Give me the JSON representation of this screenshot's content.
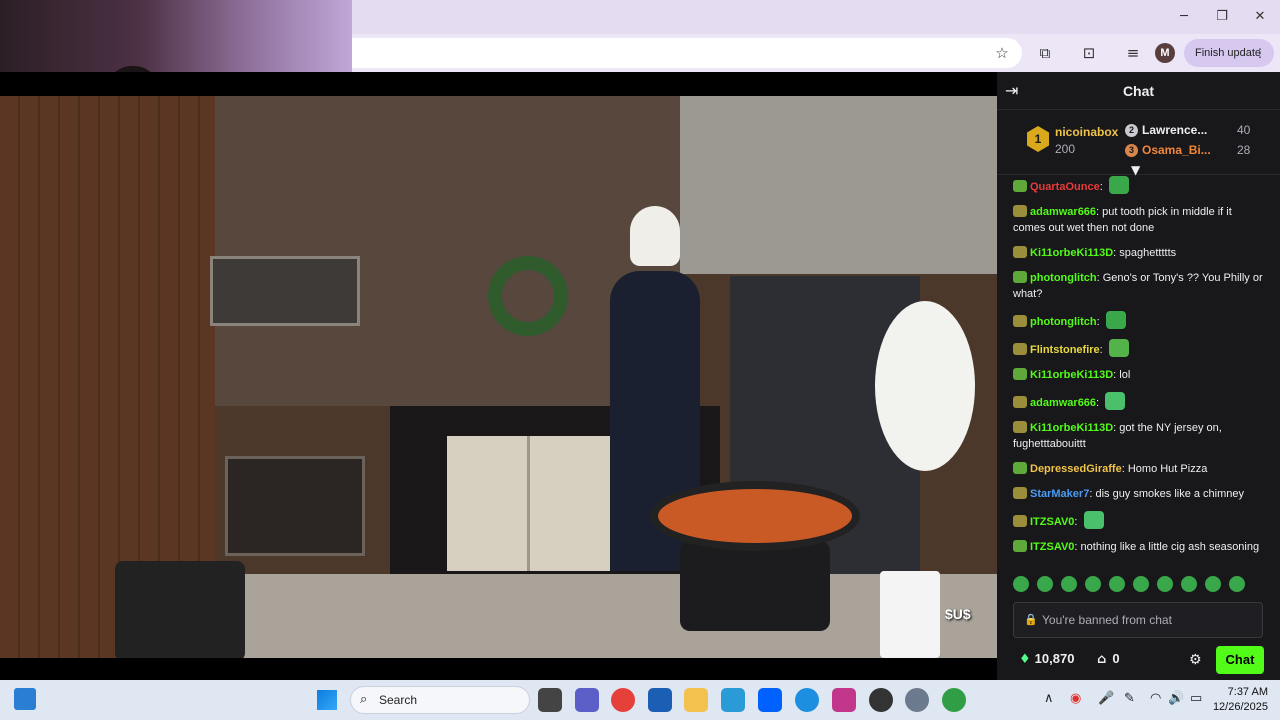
{
  "window": {
    "minimize": "─",
    "maximize": "❐",
    "close": "✕"
  },
  "toolbar": {
    "star_icon": "☆",
    "extensions_icon": "⧉",
    "cast_icon": "⊡",
    "media_icon": "≡",
    "profile_initial": "M",
    "finish_update_label": "Finish update",
    "menu_icon": "⋮"
  },
  "video": {
    "watermark": "$U$"
  },
  "chat": {
    "title": "Chat",
    "collapse_icon": "⇥",
    "leaderboard": {
      "first": {
        "rank": "1",
        "name": "nicoinabox",
        "score": "200"
      },
      "second": {
        "rank": "2",
        "name": "Lawrence...",
        "score": "40"
      },
      "third": {
        "rank": "3",
        "name": "Osama_Bi...",
        "score": "28"
      },
      "caret": "▼"
    },
    "messages": [
      {
        "user": "QuartaOunce",
        "color": "#e83a3a",
        "text": ""
      },
      {
        "user": "adamwar666",
        "color": "#53fc18",
        "text": "put tooth pick in middle if it comes out wet then not done"
      },
      {
        "user": "Ki11orbeKi113D",
        "color": "#53fc18",
        "text": "spaghettttts"
      },
      {
        "user": "photonglitch",
        "color": "#53fc18",
        "text": "Geno's or Tony's ?? You Philly or what?"
      },
      {
        "user": "photonglitch",
        "color": "#53fc18",
        "text": ""
      },
      {
        "user": "Flintstonefire",
        "color": "#e9d93f",
        "text": ""
      },
      {
        "user": "Ki11orbeKi113D",
        "color": "#53fc18",
        "text": "lol"
      },
      {
        "user": "adamwar666",
        "color": "#53fc18",
        "text": ""
      },
      {
        "user": "Ki11orbeKi113D",
        "color": "#53fc18",
        "text": "got the NY jersey on, fughetttabouittt"
      },
      {
        "user": "DepressedGiraffe",
        "color": "#f0c34a",
        "text": "Homo Hut Pizza"
      },
      {
        "user": "StarMaker7",
        "color": "#4a9cf5",
        "text": "dis guy smokes like a chimney"
      },
      {
        "user": "ITZSAV0",
        "color": "#53fc18",
        "text": ""
      },
      {
        "user": "ITZSAV0",
        "color": "#53fc18",
        "text": "nothing like a little cig ash seasoning"
      }
    ],
    "input_placeholder": "You're banned from chat",
    "lock_icon": "🔒",
    "points": "10,870",
    "points_icon": "♦",
    "gifts": "0",
    "gift_icon": "⌂",
    "settings_icon": "⚙",
    "send_label": "Chat"
  },
  "taskbar": {
    "search_label": "Search",
    "search_icon": "⌕",
    "clock_time": "7:37 AM",
    "clock_date": "12/26/2025",
    "tray": {
      "chevron": "∧",
      "mic": "🎤",
      "wifi": "◠",
      "volume": "🔊",
      "battery": "▭"
    }
  },
  "colors": {
    "kick_green": "#53fc18",
    "chat_bg": "#18181b",
    "taskbar_bg": "#dfe7f2"
  }
}
